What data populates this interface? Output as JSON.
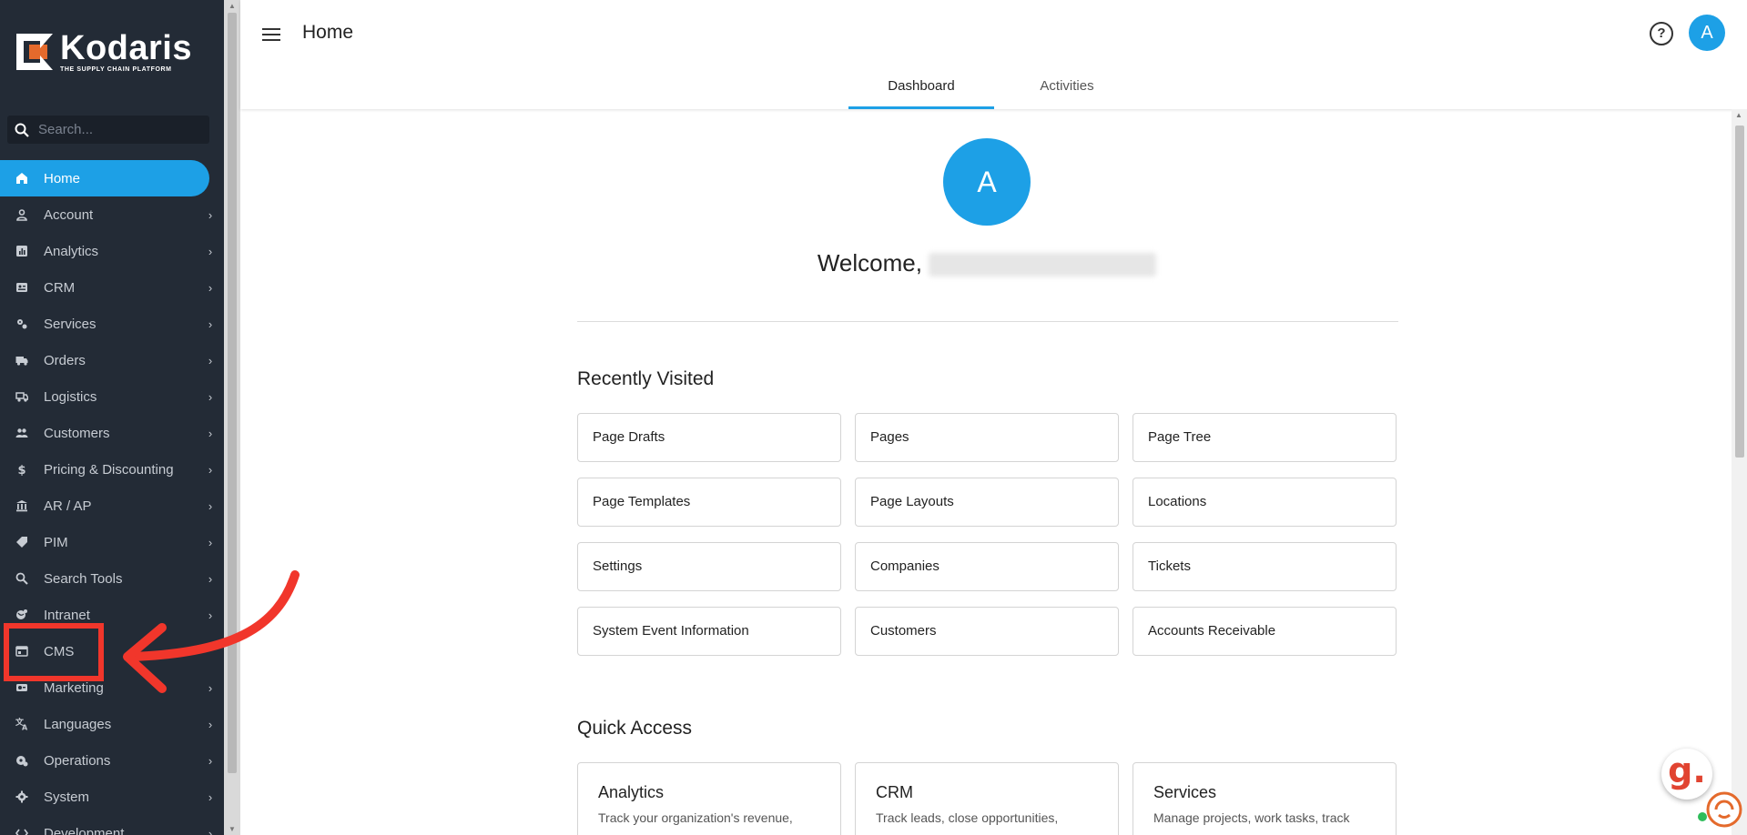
{
  "brand": {
    "name": "Kodaris",
    "tagline": "THE SUPPLY CHAIN PLATFORM"
  },
  "search": {
    "placeholder": "Search..."
  },
  "sidebar": {
    "items": [
      {
        "label": "Home",
        "icon": "home-icon",
        "active": true,
        "chevron": false
      },
      {
        "label": "Account",
        "icon": "account-icon",
        "chevron": true
      },
      {
        "label": "Analytics",
        "icon": "analytics-icon",
        "chevron": true
      },
      {
        "label": "CRM",
        "icon": "crm-icon",
        "chevron": true
      },
      {
        "label": "Services",
        "icon": "services-icon",
        "chevron": true
      },
      {
        "label": "Orders",
        "icon": "orders-icon",
        "chevron": true
      },
      {
        "label": "Logistics",
        "icon": "logistics-icon",
        "chevron": true
      },
      {
        "label": "Customers",
        "icon": "customers-icon",
        "chevron": true
      },
      {
        "label": "Pricing & Discounting",
        "icon": "pricing-icon",
        "chevron": true
      },
      {
        "label": "AR / AP",
        "icon": "bank-icon",
        "chevron": true
      },
      {
        "label": "PIM",
        "icon": "tag-icon",
        "chevron": true
      },
      {
        "label": "Search Tools",
        "icon": "search-tools-icon",
        "chevron": true
      },
      {
        "label": "Intranet",
        "icon": "intranet-icon",
        "chevron": true
      },
      {
        "label": "CMS",
        "icon": "cms-icon",
        "chevron": false
      },
      {
        "label": "Marketing",
        "icon": "marketing-icon",
        "chevron": true
      },
      {
        "label": "Languages",
        "icon": "translate-icon",
        "chevron": true
      },
      {
        "label": "Operations",
        "icon": "operations-icon",
        "chevron": true
      },
      {
        "label": "System",
        "icon": "gear-icon",
        "chevron": true
      },
      {
        "label": "Development",
        "icon": "code-icon",
        "chevron": true
      }
    ]
  },
  "header": {
    "title": "Home",
    "help_glyph": "?",
    "user_initial": "A",
    "tabs": [
      {
        "label": "Dashboard",
        "active": true
      },
      {
        "label": "Activities",
        "active": false
      }
    ]
  },
  "main": {
    "avatar_initial": "A",
    "welcome_text": "Welcome,",
    "recently_visited_title": "Recently Visited",
    "recently_visited": [
      "Page Drafts",
      "Pages",
      "Page Tree",
      "Page Templates",
      "Page Layouts",
      "Locations",
      "Settings",
      "Companies",
      "Tickets",
      "System Event Information",
      "Customers",
      "Accounts Receivable"
    ],
    "quick_access_title": "Quick Access",
    "quick_access": [
      {
        "title": "Analytics",
        "desc": "Track your organization's revenue,"
      },
      {
        "title": "CRM",
        "desc": "Track leads, close opportunities,"
      },
      {
        "title": "Services",
        "desc": "Manage projects, work tasks, track"
      }
    ]
  },
  "floating": {
    "g_glyph": "g."
  },
  "colors": {
    "accent": "#1da0e6",
    "sidebar_bg": "#232b36",
    "annotation": "#f1362b"
  }
}
